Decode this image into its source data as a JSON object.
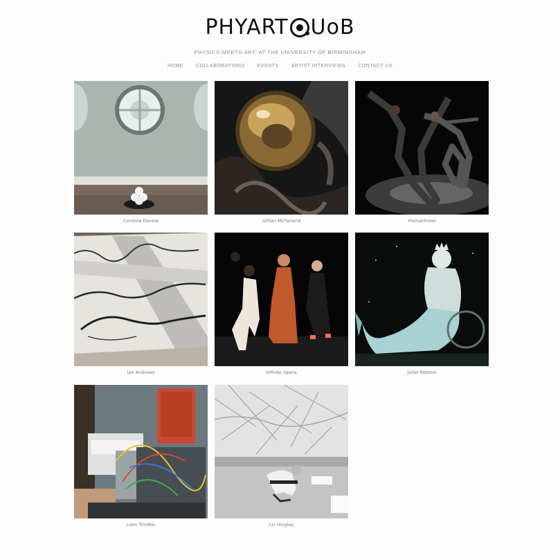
{
  "site": {
    "logo_left": "PHYART",
    "logo_right": "UoB",
    "tagline": "Physics-Meets-Art, at the University of Birmingham"
  },
  "nav": {
    "home": "Home",
    "collaborations": "Collaborations",
    "events": "Events",
    "artist_interviews": "Artist Interviews",
    "contact": "Contact Us"
  },
  "gallery": {
    "items": [
      {
        "caption": "Caroline Devine"
      },
      {
        "caption": "Gillian McFarland"
      },
      {
        "caption": "Humanhood"
      },
      {
        "caption": "Ian Andrews"
      },
      {
        "caption": "Infinite Opera"
      },
      {
        "caption": "Juliet Robson"
      },
      {
        "caption": "Leon Trimble"
      },
      {
        "caption": "Liz Hingley"
      }
    ]
  },
  "colors": {
    "background": "#fdfdfd",
    "text_muted": "#8a8a8a",
    "logo": "#111111"
  }
}
